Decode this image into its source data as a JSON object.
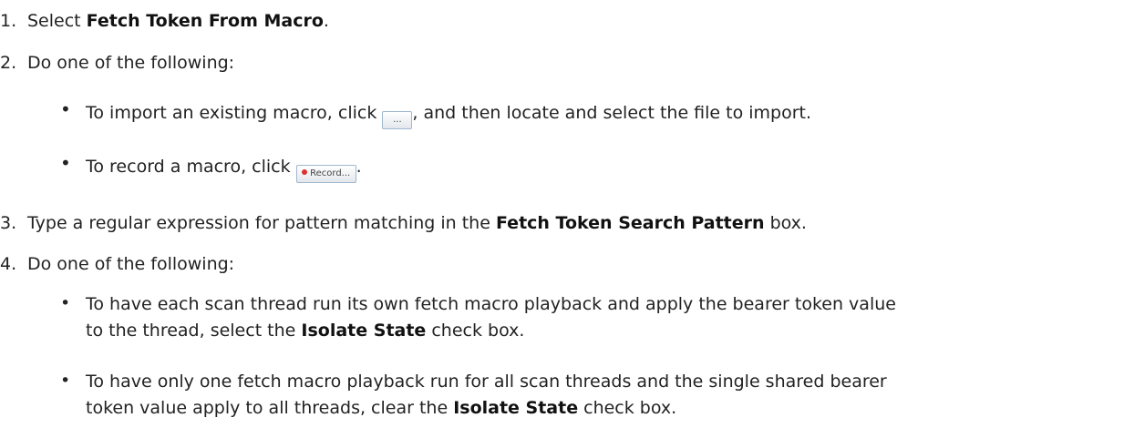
{
  "steps": [
    {
      "number": "1.",
      "pre": "Select ",
      "bold": "Fetch Token From Macro",
      "post": "."
    },
    {
      "number": "2.",
      "text": "Do one of the following:"
    },
    {
      "number": "3.",
      "pre": "Type a regular expression for pattern matching in the ",
      "bold": "Fetch Token Search Pattern",
      "post": " box."
    },
    {
      "number": "4.",
      "text": "Do one of the following:"
    }
  ],
  "step2_options": [
    {
      "bullet": "•",
      "pre": "To import an existing macro, click ",
      "button": "...",
      "post": ", and then locate and select the file to import."
    },
    {
      "bullet": "•",
      "pre": "To record a macro, click ",
      "button": "Record...",
      "post": "."
    }
  ],
  "step4_options": [
    {
      "bullet": "•",
      "line1": "To have each scan thread run its own fetch macro playback and apply the bearer token value",
      "line2_pre": "to the thread, select the ",
      "line2_bold": "Isolate State",
      "line2_post": " check box."
    },
    {
      "bullet": "•",
      "line1": "To have only one fetch macro playback run for all scan threads and the single shared bearer",
      "line2_pre": "token value apply to all threads, clear the ",
      "line2_bold": "Isolate State",
      "line2_post": " check box."
    }
  ]
}
